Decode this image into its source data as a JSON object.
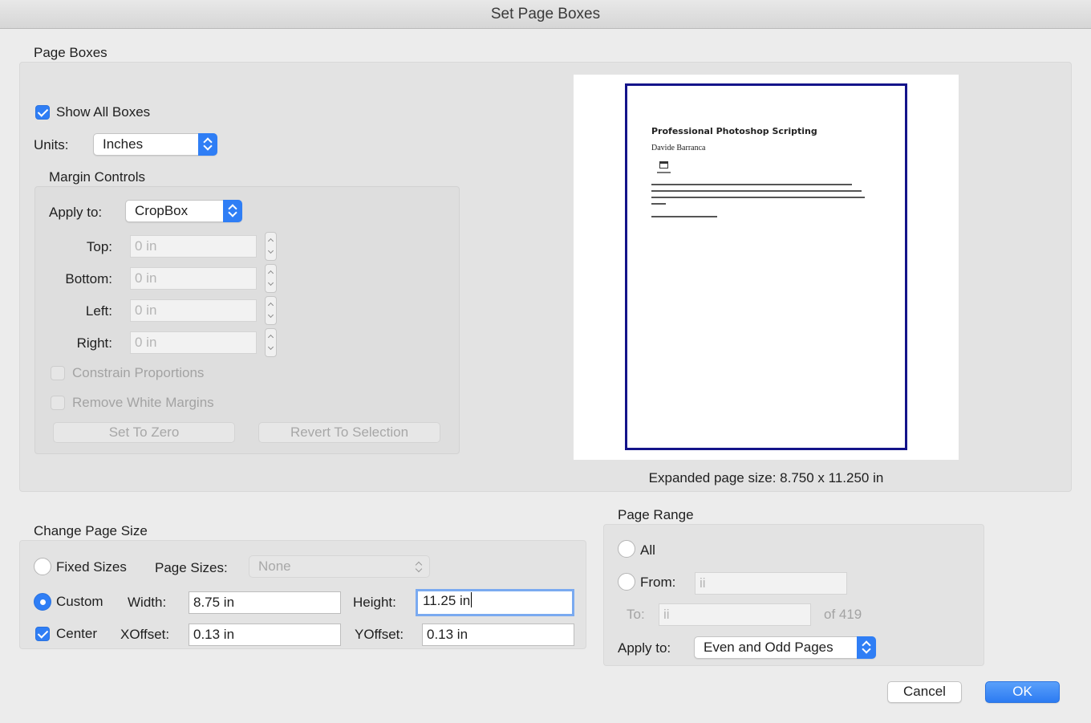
{
  "window": {
    "title": "Set Page Boxes"
  },
  "page_boxes": {
    "section_title": "Page Boxes",
    "show_all_boxes": {
      "label": "Show All Boxes",
      "checked": true
    },
    "units": {
      "label": "Units:",
      "value": "Inches"
    },
    "margin_controls": {
      "title": "Margin Controls",
      "apply_to": {
        "label": "Apply to:",
        "value": "CropBox"
      },
      "top": {
        "label": "Top:",
        "placeholder": "0 in"
      },
      "bottom": {
        "label": "Bottom:",
        "placeholder": "0 in"
      },
      "left": {
        "label": "Left:",
        "placeholder": "0 in"
      },
      "right": {
        "label": "Right:",
        "placeholder": "0 in"
      },
      "constrain_proportions": {
        "label": "Constrain Proportions",
        "checked": false
      },
      "remove_white_margins": {
        "label": "Remove White Margins",
        "checked": false
      },
      "set_to_zero_label": "Set To Zero",
      "revert_label": "Revert To Selection"
    },
    "preview": {
      "doc_title": "Professional Photoshop Scripting",
      "doc_author": "Davide Barranca",
      "page_size_text": "Expanded page size: 8.750 x 11.250 in"
    }
  },
  "change_page_size": {
    "section_title": "Change Page Size",
    "fixed_sizes": {
      "label": "Fixed Sizes",
      "selected": false
    },
    "page_sizes": {
      "label": "Page Sizes:",
      "value": "None"
    },
    "custom": {
      "label": "Custom",
      "selected": true
    },
    "width": {
      "label": "Width:",
      "value": "8.75 in"
    },
    "height": {
      "label": "Height:",
      "value": "11.25 in"
    },
    "center": {
      "label": "Center",
      "checked": true
    },
    "xoffset": {
      "label": "XOffset:",
      "value": "0.13 in"
    },
    "yoffset": {
      "label": "YOffset:",
      "value": "0.13 in"
    }
  },
  "page_range": {
    "section_title": "Page Range",
    "all": {
      "label": "All",
      "selected": false
    },
    "from": {
      "label": "From:",
      "placeholder": "ii"
    },
    "to": {
      "label": "To:",
      "placeholder": "ii"
    },
    "of_total": "of 419",
    "apply_to": {
      "label": "Apply to:",
      "value": "Even and Odd Pages"
    }
  },
  "footer": {
    "cancel_label": "Cancel",
    "ok_label": "OK"
  },
  "colors": {
    "accent": "#2f7ef5",
    "page_border": "#14148a"
  }
}
